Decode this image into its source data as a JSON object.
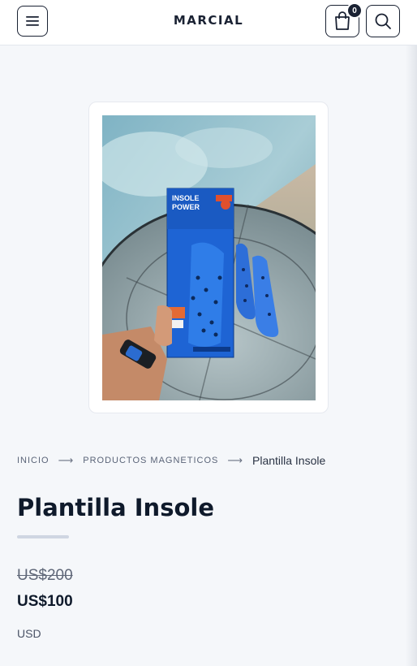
{
  "header": {
    "logo": "MARCIAL",
    "cart_count": "0"
  },
  "product": {
    "image_alt": "Plantilla Insole package held in hand with insoles on glass table",
    "title": "Plantilla Insole",
    "old_price": "US$200",
    "price": "US$100",
    "currency": "USD"
  },
  "breadcrumb": {
    "home": "INICIO",
    "category": "PRODUCTOS MAGNETICOS",
    "current": "Plantilla Insole",
    "separator": "⟶"
  },
  "box_text": {
    "brand_line1": "INSOLE",
    "brand_line2": "POWER"
  },
  "colors": {
    "dark": "#1a2233",
    "rule": "#cfd6e2"
  }
}
